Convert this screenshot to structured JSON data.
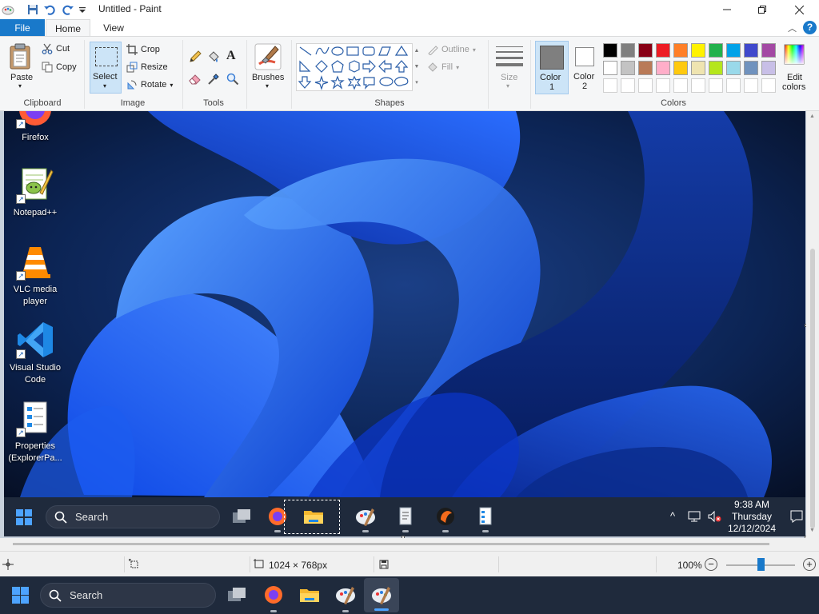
{
  "window": {
    "title": "Untitled - Paint",
    "controls": [
      "minimize",
      "maximize",
      "close"
    ]
  },
  "menu": {
    "tabs": [
      "File",
      "Home",
      "View"
    ],
    "active": "Home"
  },
  "ribbon": {
    "clipboard": {
      "paste": "Paste",
      "cut": "Cut",
      "copy": "Copy",
      "label": "Clipboard"
    },
    "image": {
      "select": "Select",
      "crop": "Crop",
      "resize": "Resize",
      "rotate": "Rotate",
      "label": "Image"
    },
    "tools": {
      "label": "Tools"
    },
    "brushes": {
      "label": "Brushes"
    },
    "shapes": {
      "outline": "Outline",
      "fill": "Fill",
      "label": "Shapes"
    },
    "size": {
      "label": "Size"
    },
    "colors": {
      "color1_label": "Color",
      "color1_num": "1",
      "color2_label": "Color",
      "color2_num": "2",
      "edit_label": "Edit",
      "edit_label2": "colors",
      "label": "Colors",
      "color1_value": "#7f7f7f",
      "color2_value": "#ffffff",
      "palette_row1": [
        "#000000",
        "#7f7f7f",
        "#880015",
        "#ed1c24",
        "#ff7f27",
        "#fff200",
        "#22b14c",
        "#00a2e8",
        "#3f48cc",
        "#a349a4"
      ],
      "palette_row2": [
        "#ffffff",
        "#c3c3c3",
        "#b97a57",
        "#ffaec9",
        "#ffc90e",
        "#efe4b0",
        "#b5e61d",
        "#99d9ea",
        "#7092be",
        "#c8bfe7"
      ]
    }
  },
  "desktop_icons": [
    {
      "label": "Firefox"
    },
    {
      "label": "Notepad++"
    },
    {
      "label": "VLC media player"
    },
    {
      "label": "Visual Studio Code"
    },
    {
      "label": "Properties (ExplorerPa..."
    }
  ],
  "inner_taskbar": {
    "search": "Search",
    "time": "9:38 AM",
    "day": "Thursday",
    "date": "12/12/2024"
  },
  "statusbar": {
    "dimensions": "1024 × 768px",
    "zoom": "100%",
    "zoom_level_fraction": 0.5
  },
  "os_taskbar": {
    "search": "Search"
  }
}
